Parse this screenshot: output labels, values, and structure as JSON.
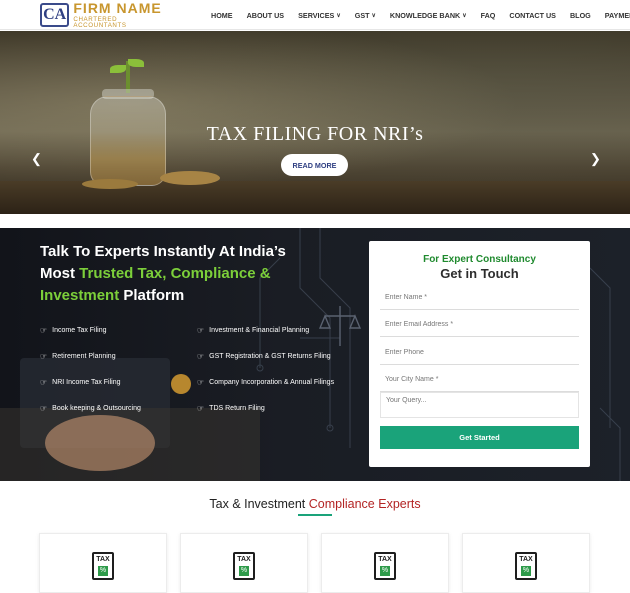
{
  "header": {
    "logo_mark": "CA",
    "logo_name": "FIRM NAME",
    "logo_sub": "CHARTERED ACCOUNTANTS",
    "nav": [
      {
        "label": "HOME",
        "dropdown": false
      },
      {
        "label": "ABOUT US",
        "dropdown": false
      },
      {
        "label": "SERVICES",
        "dropdown": true
      },
      {
        "label": "GST",
        "dropdown": true
      },
      {
        "label": "KNOWLEDGE BANK",
        "dropdown": true
      },
      {
        "label": "FAQ",
        "dropdown": false
      },
      {
        "label": "CONTACT US",
        "dropdown": false
      },
      {
        "label": "BLOG",
        "dropdown": false
      },
      {
        "label": "PAYMENTS",
        "dropdown": false
      }
    ]
  },
  "hero": {
    "title": "TAX FILING FOR NRI’s",
    "button": "READ MORE",
    "prev_icon": "chevron-left-icon",
    "next_icon": "chevron-right-icon"
  },
  "experts": {
    "line1": "Talk To Experts Instantly At India’s",
    "line2_pre": "Most ",
    "line2_green": "Trusted Tax, Compliance &",
    "line3_green": "Investment",
    "line3_post": " Platform",
    "services_left": [
      "Income Tax Filing",
      "Retirement Planning",
      "NRI Income Tax Filing",
      "Book keeping & Outsourcing"
    ],
    "services_right": [
      "Investment & Financial Planning",
      "GST Registration & GST Returns Filing",
      "Company Incorporation & Annual Filings",
      "TDS Return Filing"
    ],
    "service_icon": "hand-point-right-icon"
  },
  "form": {
    "kicker": "For Expert Consultancy",
    "title": "Get in Touch",
    "name_placeholder": "Enter Name *",
    "email_placeholder": "Enter Email Address *",
    "phone_placeholder": "Enter Phone",
    "city_placeholder": "Your City Name *",
    "query_placeholder": "Your Query...",
    "submit": "Get Started"
  },
  "compliance": {
    "title_pre": "Tax & Investment ",
    "title_red": "Compliance Experts",
    "card_icon_text": "TAX",
    "card_icon_pct": "%",
    "cards": 4
  },
  "colors": {
    "brand_blue": "#2f3f82",
    "brand_gold": "#c8962e",
    "accent_green": "#7ccf3a",
    "cta_teal": "#1aa37a",
    "accent_red": "#b32424"
  }
}
